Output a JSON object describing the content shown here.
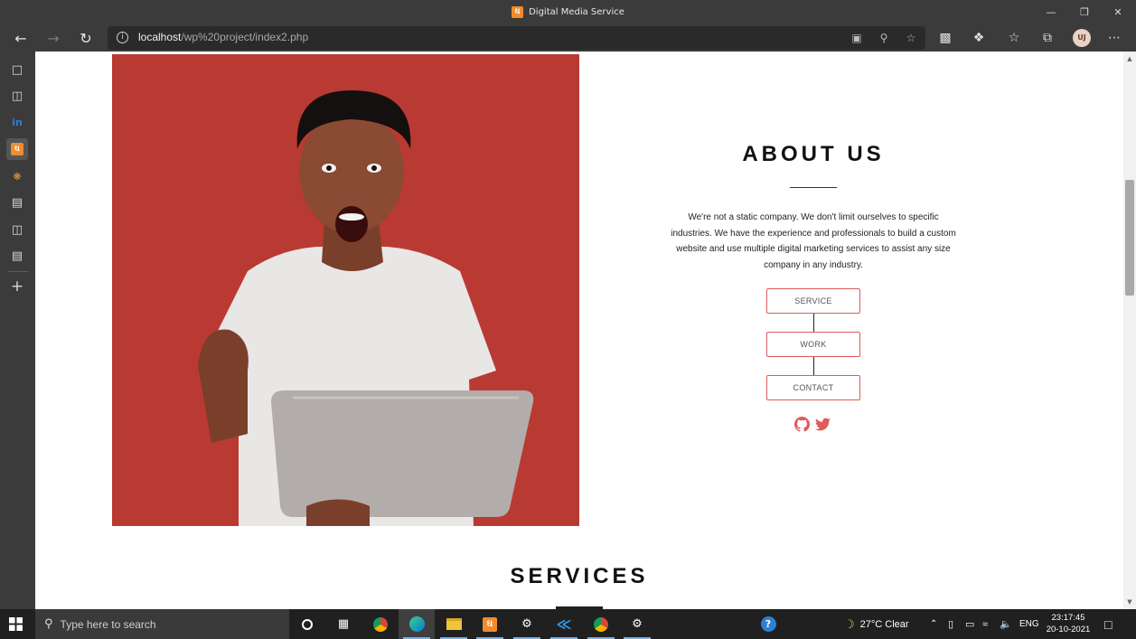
{
  "window": {
    "title": "Digital Media Service"
  },
  "browser": {
    "url_host": "localhost",
    "url_path": "/wp%20project/index2.php",
    "profile_initials": "UJ"
  },
  "about": {
    "heading": "ABOUT US",
    "body": "We're not a static company. We don't limit ourselves to specific industries. We have the experience and professionals to build a custom website and use multiple digital marketing services to assist any size company in any industry.",
    "buttons": [
      "SERVICE",
      "WORK",
      "CONTACT"
    ]
  },
  "services": {
    "heading": "SERVICES"
  },
  "taskbar": {
    "search_placeholder": "Type here to search",
    "weather": "27°C  Clear",
    "language": "ENG",
    "time": "23:17:45",
    "date": "20-10-2021"
  },
  "colors": {
    "accent": "#e05a5a",
    "photo_bg": "#b5362f",
    "chrome": "#3b3b3b"
  }
}
